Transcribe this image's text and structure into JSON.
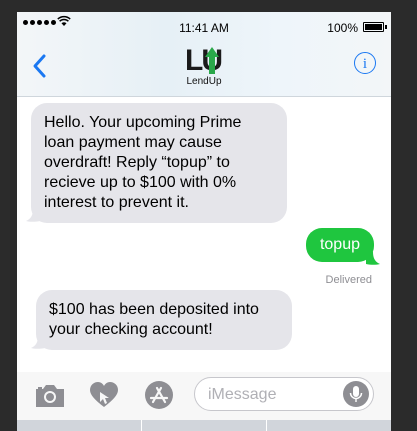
{
  "status_bar": {
    "time": "11:41 AM",
    "battery": "100%"
  },
  "header": {
    "logo_text": "LU",
    "contact_name": "LendUp",
    "info_glyph": "i"
  },
  "messages": [
    {
      "direction": "incoming",
      "text": "Hello. Your upcoming Prime loan payment may cause overdraft! Reply “topup” to recieve up to $100 with 0% interest to prevent it."
    },
    {
      "direction": "outgoing",
      "text": "topup",
      "status": "Delivered"
    },
    {
      "direction": "incoming",
      "text": "$100 has been deposited into your checking account!"
    }
  ],
  "composer": {
    "placeholder": "iMessage"
  },
  "colors": {
    "accent": "#1a78f2",
    "outgoing_bubble": "#1fc63f",
    "incoming_bubble": "#e5e5ea",
    "logo_green": "#2aa84a"
  },
  "icons": [
    "back-chevron-icon",
    "info-icon",
    "camera-icon",
    "digital-touch-heart-icon",
    "app-store-icon",
    "microphone-icon",
    "signal-icon",
    "wifi-icon",
    "battery-icon"
  ]
}
